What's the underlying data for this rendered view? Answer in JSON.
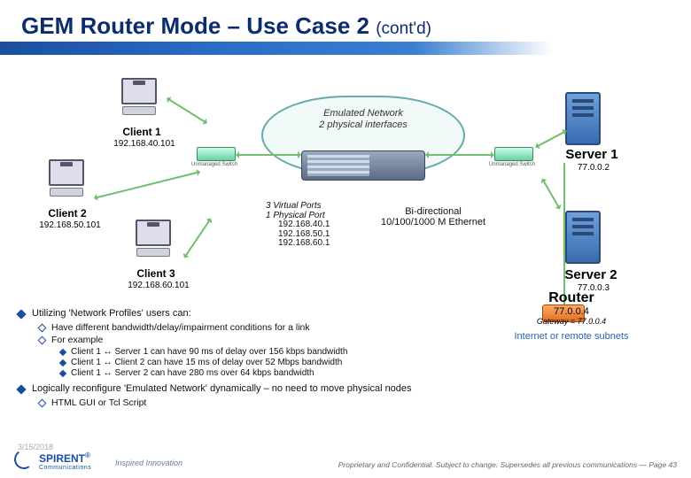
{
  "title": {
    "main": "GEM Router Mode – Use Case 2 ",
    "sub": "(cont'd)"
  },
  "diagram": {
    "client1": {
      "label": "Client 1",
      "ip": "192.168.40.101"
    },
    "client2": {
      "label": "Client 2",
      "ip": "192.168.50.101"
    },
    "client3": {
      "label": "Client 3",
      "ip": "192.168.60.101"
    },
    "server1": {
      "label": "Server 1",
      "ip": "77.0.0.2"
    },
    "server2": {
      "label": "Server 2",
      "ip": "77.0.0.3"
    },
    "switch_label": "Unmanaged Switch",
    "cloud": {
      "line1": "Emulated Network",
      "line2": "2  physical interfaces"
    },
    "vports": {
      "title": "3 Virtual Ports",
      "sub": "1 Physical Port",
      "p1": "192.168.40.1",
      "p2": "192.168.50.1",
      "p3": "192.168.60.1"
    },
    "link": {
      "line1": "Bi-directional",
      "line2": "10/100/1000 M Ethernet"
    },
    "router": {
      "label": "Router",
      "ip": "77.0.0.4",
      "gw": "Gateway = 77.0.0.4",
      "inet": "Internet or remote subnets"
    }
  },
  "bullets": {
    "l1a": "Utilizing 'Network Profiles' users can:",
    "l2a": "Have different bandwidth/delay/impairment conditions for a link",
    "l2b": "For example",
    "l3a": "Client 1 ↔ Server 1 can have 90 ms of delay over 156 kbps bandwidth",
    "l3b": "Client 1 ↔ Client 2 can have 15 ms of delay over 52 Mbps bandwidth",
    "l3c": "Client 1 ↔ Server 2 can have 280 ms over 64 kbps bandwidth",
    "l1b": "Logically reconfigure 'Emulated Network' dynamically – no need to move physical nodes",
    "l2c": "HTML GUI or Tcl Script"
  },
  "meta": {
    "date": "3/15/2018",
    "logo": "SPIRENT",
    "logo_sub": "Communications",
    "tagline": "Inspired Innovation",
    "footer": "Proprietary and Confidential.  Subject to change.  Supersedes all previous communications — Page 43"
  }
}
